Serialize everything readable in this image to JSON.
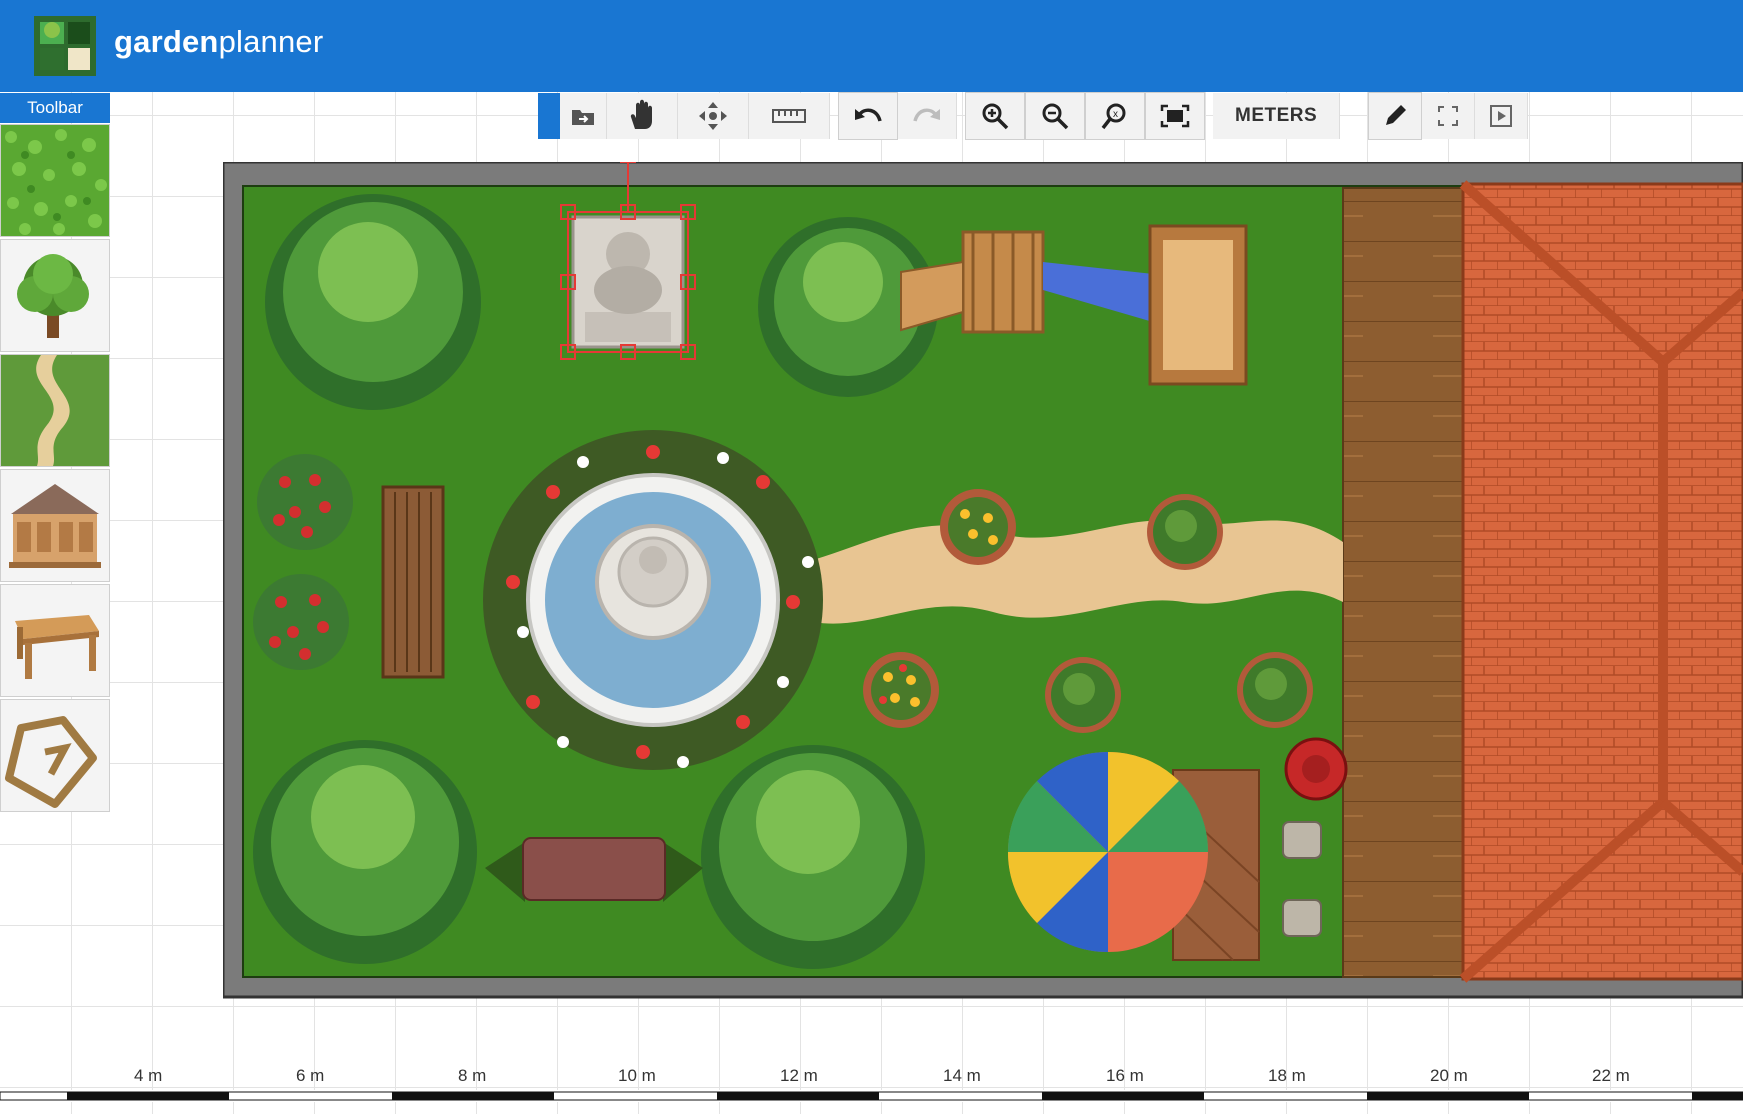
{
  "app": {
    "brand_bold": "garden",
    "brand_light": "planner"
  },
  "toolbar": {
    "title": "Toolbar",
    "palette": [
      {
        "name": "grass",
        "icon": "grass-texture-icon"
      },
      {
        "name": "tree",
        "icon": "tree-icon"
      },
      {
        "name": "path",
        "icon": "path-icon"
      },
      {
        "name": "gazebo",
        "icon": "gazebo-icon"
      },
      {
        "name": "table",
        "icon": "table-icon"
      },
      {
        "name": "polygon",
        "icon": "polygon-shape-icon"
      }
    ]
  },
  "top_toolbar": {
    "units_label": "METERS",
    "tools": [
      "import-icon",
      "hand-pan-icon",
      "move-icon",
      "measure-ruler-icon",
      "undo-icon",
      "redo-icon",
      "zoom-in-icon",
      "zoom-out-icon",
      "zoom-reset-icon",
      "fit-screen-icon",
      "pencil-icon",
      "fullscreen-icon",
      "present-icon"
    ]
  },
  "ruler": {
    "labels": [
      "4 m",
      "6 m",
      "8 m",
      "10 m",
      "12 m",
      "14 m",
      "16 m",
      "18 m",
      "20 m",
      "22 m"
    ]
  },
  "colors": {
    "header": "#1976d2",
    "lawn": "#3f8a22",
    "deck": "#8a5a2b",
    "roof": "#d9663c",
    "path": "#e8c592",
    "selection": "#e53935"
  }
}
